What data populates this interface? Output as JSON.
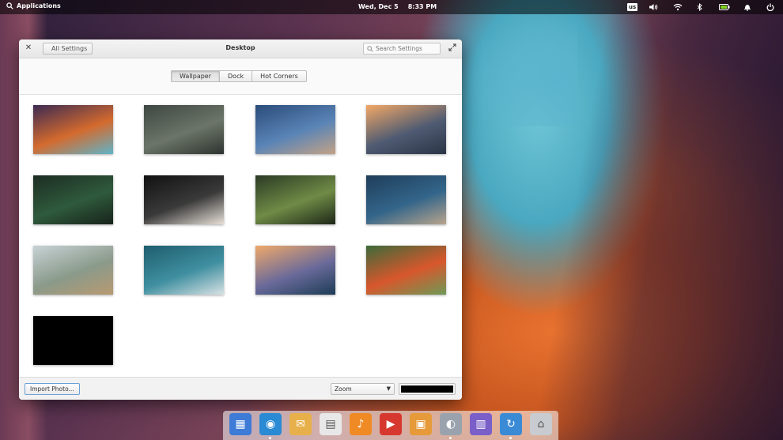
{
  "panel": {
    "applications_label": "Applications",
    "date": "Wed, Dec  5",
    "time": "8:33 PM",
    "keyboard_layout": "us"
  },
  "window": {
    "title": "Desktop",
    "back_label": "All Settings",
    "search_placeholder": "Search Settings"
  },
  "tabs": [
    {
      "label": "Wallpaper",
      "active": true
    },
    {
      "label": "Dock",
      "active": false
    },
    {
      "label": "Hot Corners",
      "active": false
    }
  ],
  "wallpapers": [
    {
      "name": "antelope-canyon",
      "colors": [
        "#3c2a52",
        "#d46a2e",
        "#5fb4c9"
      ]
    },
    {
      "name": "foggy-forest",
      "colors": [
        "#3e4642",
        "#6c7568",
        "#2d3430"
      ]
    },
    {
      "name": "ocean-pier",
      "colors": [
        "#2a4c7a",
        "#5a84b6",
        "#c4a286"
      ]
    },
    {
      "name": "mountain-sunset",
      "colors": [
        "#f3a866",
        "#4f5b72",
        "#2b3446"
      ]
    },
    {
      "name": "fern",
      "colors": [
        "#1c2c22",
        "#2f5a3c",
        "#17221a"
      ]
    },
    {
      "name": "sign-dark",
      "colors": [
        "#111111",
        "#3a3a3a",
        "#e8e0d8"
      ]
    },
    {
      "name": "pine-branch",
      "colors": [
        "#2b3a24",
        "#6f8b46",
        "#1d2718"
      ]
    },
    {
      "name": "mountain-road",
      "colors": [
        "#1f3d5a",
        "#33658a",
        "#b8a48c"
      ]
    },
    {
      "name": "beach-dunes",
      "colors": [
        "#c8d2d6",
        "#8a9a8a",
        "#b89a72"
      ]
    },
    {
      "name": "snowy-mountains",
      "colors": [
        "#1e5d6e",
        "#3f8fa0",
        "#d9e2e4"
      ]
    },
    {
      "name": "dusk-pier",
      "colors": [
        "#f0a96a",
        "#6a6a9a",
        "#1c3c56"
      ]
    },
    {
      "name": "tulips",
      "colors": [
        "#3c6a3a",
        "#d8572c",
        "#6d9a56"
      ]
    },
    {
      "name": "solid-black",
      "colors": [
        "#000000",
        "#000000",
        "#000000"
      ]
    }
  ],
  "footer": {
    "import_label": "Import Photo...",
    "zoom_value": "Zoom",
    "primary_color": "#000000"
  },
  "dock": [
    {
      "name": "multitasking-view",
      "color": "#3d7bd6"
    },
    {
      "name": "web-browser",
      "color": "#2a8ad4"
    },
    {
      "name": "mail",
      "color": "#e8b04a"
    },
    {
      "name": "calendar",
      "color": "#e8e8e8"
    },
    {
      "name": "music",
      "color": "#f08a24"
    },
    {
      "name": "videos",
      "color": "#d6382f"
    },
    {
      "name": "photos",
      "color": "#e69a3a"
    },
    {
      "name": "system-settings",
      "color": "#9aa3ad"
    },
    {
      "name": "appcenter",
      "color": "#7a5fc8"
    },
    {
      "name": "software-update",
      "color": "#3a8ad6"
    },
    {
      "name": "files",
      "color": "#c8ccd0"
    }
  ]
}
